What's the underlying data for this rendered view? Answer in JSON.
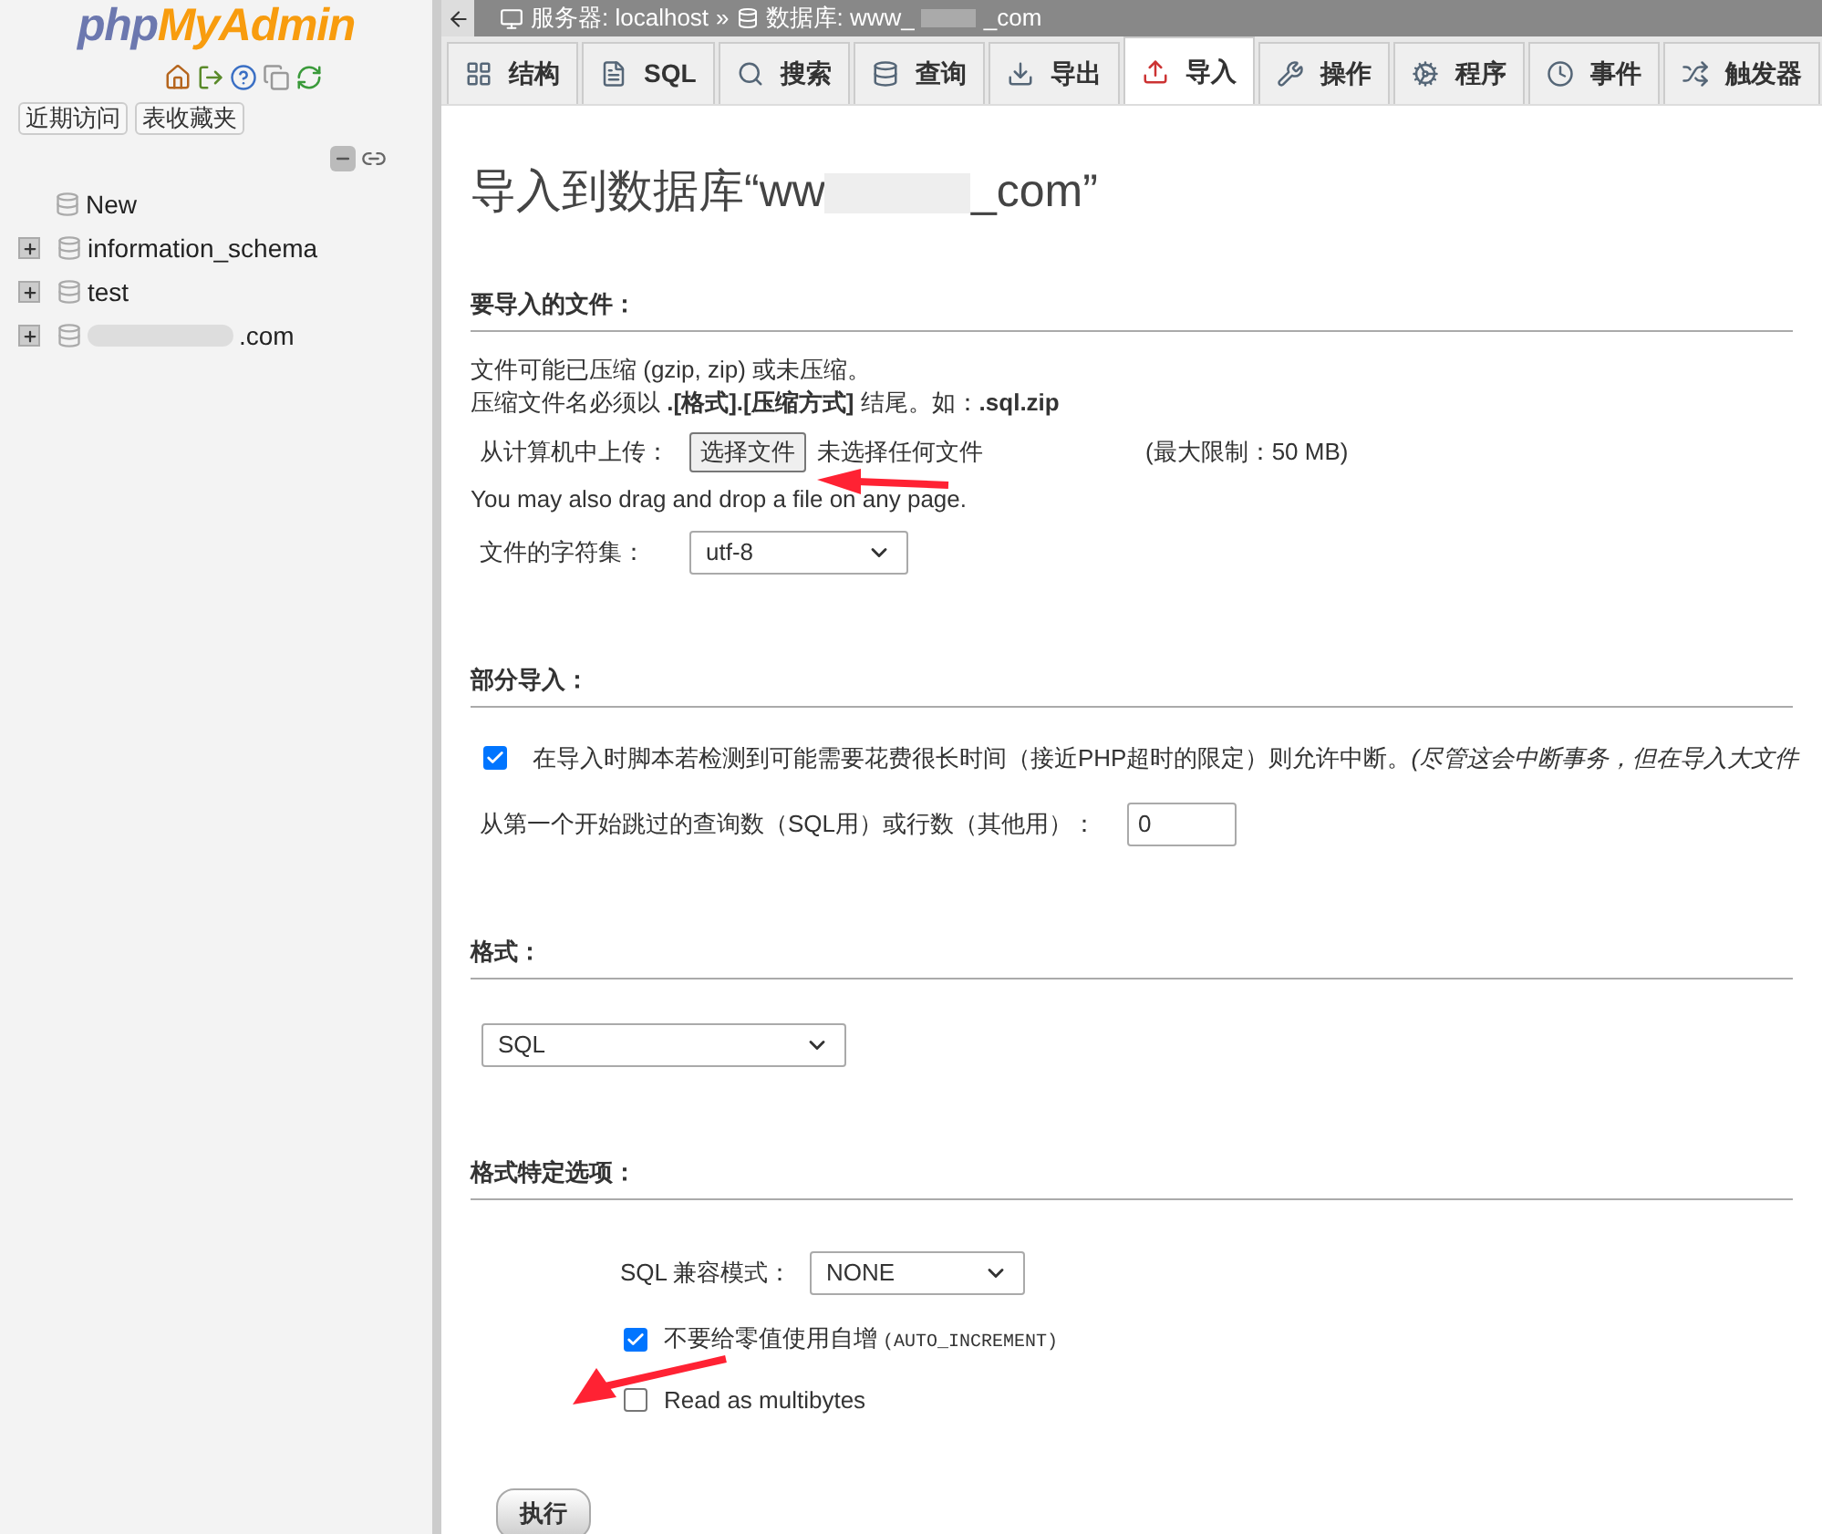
{
  "sidebar": {
    "logo": {
      "php": "php",
      "myadmin": "MyAdmin"
    },
    "buttons": [
      "近期访问",
      "表收藏夹"
    ],
    "tree": [
      {
        "kind": "new",
        "label": "New"
      },
      {
        "kind": "db",
        "label": "information_schema",
        "expanded": false
      },
      {
        "kind": "db",
        "label": "test",
        "expanded": false
      },
      {
        "kind": "redacted_db",
        "label": ".com",
        "expanded": false
      }
    ]
  },
  "breadcrumb": {
    "server": "服务器: localhost",
    "separator": "»",
    "database_prefix": "数据库: www_",
    "database_suffix": "_com"
  },
  "tabs": [
    {
      "label": "结构",
      "selected": false
    },
    {
      "label": "SQL",
      "selected": false
    },
    {
      "label": "搜索",
      "selected": false
    },
    {
      "label": "查询",
      "selected": false
    },
    {
      "label": "导出",
      "selected": false
    },
    {
      "label": "导入",
      "selected": true
    },
    {
      "label": "操作",
      "selected": false
    },
    {
      "label": "程序",
      "selected": false
    },
    {
      "label": "事件",
      "selected": false
    },
    {
      "label": "触发器",
      "selected": false
    }
  ],
  "page_title": {
    "prefix": "导入到数据库“ww",
    "suffix": "_com”"
  },
  "file_section": {
    "heading": "要导入的文件：",
    "note_1": "文件可能已压缩 (gzip, zip) 或未压缩。",
    "note_2": "压缩文件名必须以 **.[格式].[压缩方式]** 结尾。如：**.sql.zip**",
    "upload_label": "从计算机中上传：",
    "choose_button": "选择文件",
    "no_file": "未选择任何文件",
    "max_size": "(最大限制：50 MB)",
    "drag_note": "You may also drag and drop a file on any page.",
    "charset_label": "文件的字符集：",
    "charset_value": "utf-8"
  },
  "partial_section": {
    "heading": "部分导入：",
    "allow_interrupt": {
      "checked": true,
      "text": "在导入时脚本若检测到可能需要花费很长时间（接近PHP超时的限定）则允许中断。*(尽管这会中断事务，但在导入大文件*"
    },
    "skip_label": "从第一个开始跳过的查询数（SQL用）或行数（其他用）：",
    "skip_value": "0"
  },
  "format_section": {
    "heading": "格式：",
    "value": "SQL"
  },
  "options_section": {
    "heading": "格式特定选项：",
    "compat_label": "SQL 兼容模式：",
    "compat_value": "NONE",
    "options": [
      {
        "label": "不要给零值使用自增",
        "code": "(AUTO_INCREMENT)",
        "checked": true
      },
      {
        "label": "Read as multibytes",
        "checked": false
      }
    ]
  },
  "go_button": "执行"
}
